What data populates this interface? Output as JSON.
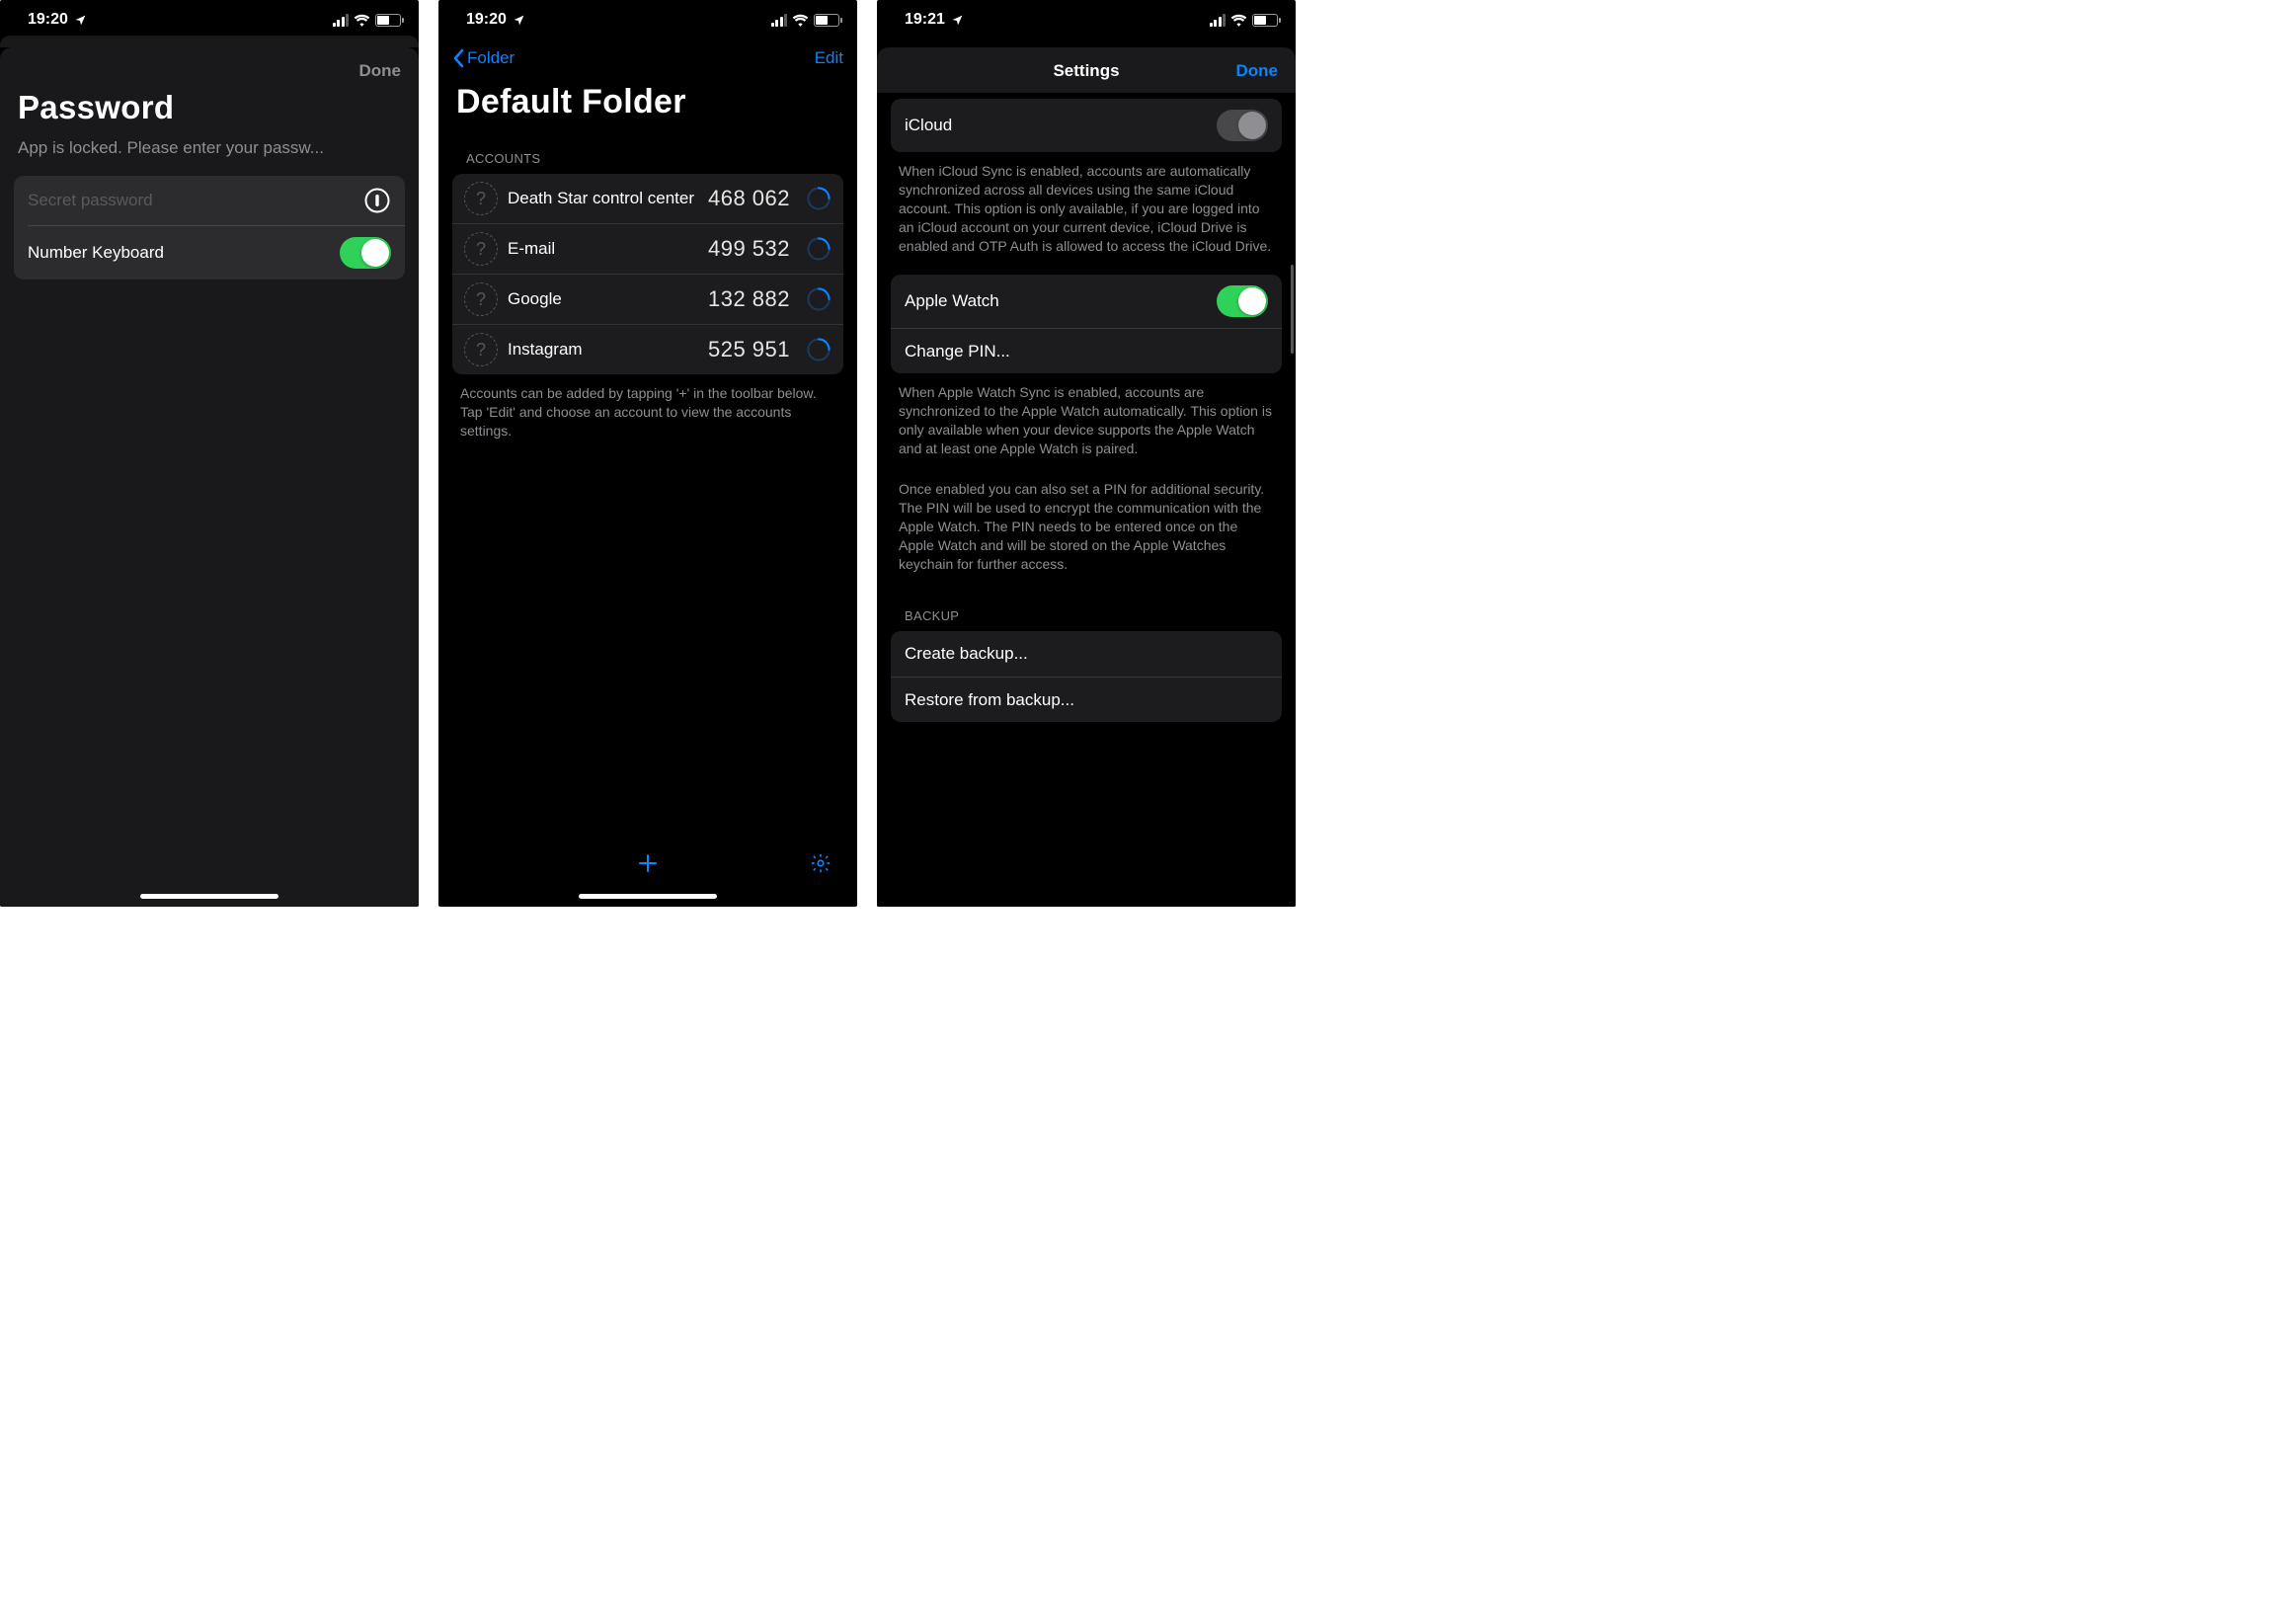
{
  "screen1": {
    "time": "19:20",
    "done_label": "Done",
    "title": "Password",
    "subtitle": "App is locked. Please enter your passw...",
    "placeholder": "Secret password",
    "number_keyboard_label": "Number Keyboard"
  },
  "screen2": {
    "time": "19:20",
    "back_label": "Folder",
    "edit_label": "Edit",
    "title": "Default Folder",
    "section_header": "Accounts",
    "accounts": [
      {
        "name": "Death Star control center",
        "code": "468 062"
      },
      {
        "name": "E-mail",
        "code": "499 532"
      },
      {
        "name": "Google",
        "code": "132 882"
      },
      {
        "name": "Instagram",
        "code": "525 951"
      }
    ],
    "footer": "Accounts can be added by tapping '+' in the toolbar below. Tap 'Edit' and choose an account to view the accounts settings."
  },
  "screen3": {
    "time": "19:21",
    "title": "Settings",
    "done_label": "Done",
    "icloud_label": "iCloud",
    "icloud_footer": "When iCloud Sync is enabled, accounts are automatically synchronized across all devices using the same iCloud account. This option is only available, if you are logged into an iCloud account on your current device, iCloud Drive is enabled and OTP Auth is allowed to access the iCloud Drive.",
    "apple_watch_label": "Apple Watch",
    "change_pin_label": "Change PIN...",
    "watch_footer_1": "When Apple Watch Sync is enabled, accounts are synchronized to the Apple Watch automatically. This option is only available when your device supports the Apple Watch and at least one Apple Watch is paired.",
    "watch_footer_2": "Once enabled you can also set a PIN for additional security. The PIN will be used to encrypt the communication with the Apple Watch. The PIN needs to be entered once on the Apple Watch and will be stored on the Apple Watches keychain for further access.",
    "backup_header": "Backup",
    "create_backup_label": "Create backup...",
    "restore_backup_label": "Restore from backup..."
  }
}
